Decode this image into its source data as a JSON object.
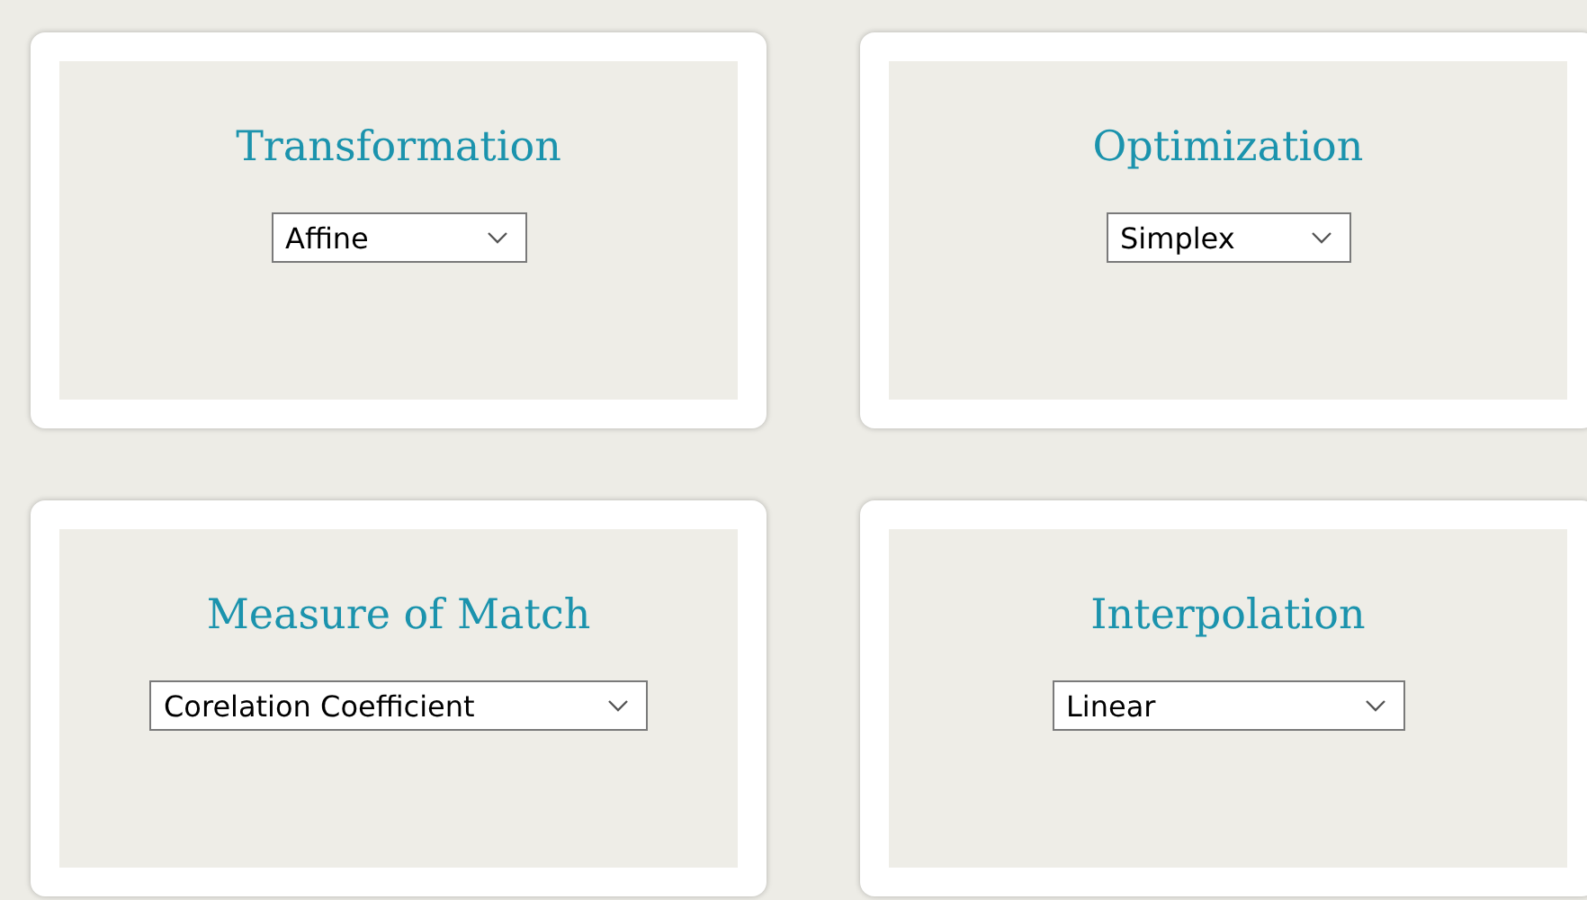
{
  "cards": [
    {
      "title": "Transformation",
      "dropdown": {
        "value": "Affine"
      }
    },
    {
      "title": "Optimization",
      "dropdown": {
        "value": "Simplex"
      }
    },
    {
      "title": "Measure of Match",
      "dropdown": {
        "value": "Corelation Coefficient"
      }
    },
    {
      "title": "Interpolation",
      "dropdown": {
        "value": "Linear"
      }
    }
  ]
}
